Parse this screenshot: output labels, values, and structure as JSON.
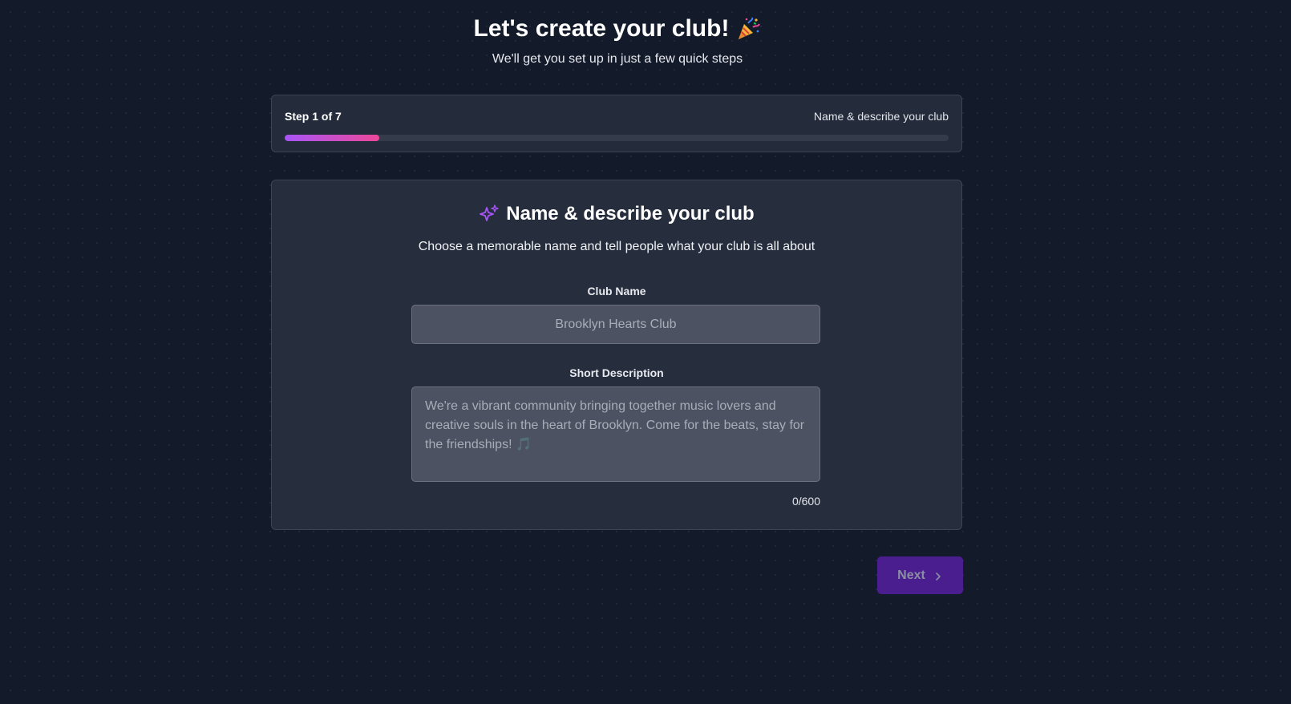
{
  "header": {
    "title": "Let's create your club!",
    "title_icon": "party-popper-icon",
    "subtitle": "We'll get you set up in just a few quick steps"
  },
  "progress": {
    "step_label": "Step 1 of 7",
    "step_name": "Name & describe your club",
    "fraction_complete": 0.143,
    "fill_gradient": [
      "#a855f7",
      "#ec4899"
    ]
  },
  "card": {
    "icon": "sparkle-icon",
    "title": "Name & describe your club",
    "description": "Choose a memorable name and tell people what your club is all about",
    "club_name": {
      "label": "Club Name",
      "value": "",
      "placeholder": "Brooklyn Hearts Club"
    },
    "short_description": {
      "label": "Short Description",
      "value": "",
      "placeholder": "We're a vibrant community bringing together music lovers and creative souls in the heart of Brooklyn. Come for the beats, stay for the friendships! 🎵",
      "char_count": "0/600"
    }
  },
  "footer": {
    "next_label": "Next",
    "next_icon": "chevron-right-icon"
  },
  "colors": {
    "background": "#131a2a",
    "card_background": "#262d3c",
    "accent_purple": "#a855f7",
    "accent_pink": "#ec4899",
    "button_background": "#4b1e8f"
  }
}
